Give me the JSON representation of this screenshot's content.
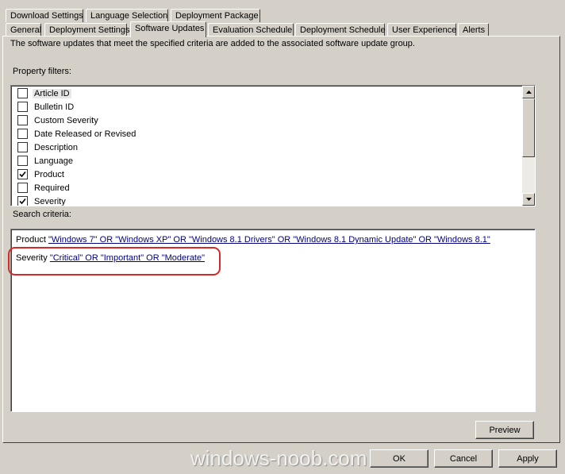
{
  "tabs_row1": [
    "Download Settings",
    "Language Selection",
    "Deployment Package"
  ],
  "tabs_row2": [
    "General",
    "Deployment Settings",
    "Software Updates",
    "Evaluation Schedule",
    "Deployment Schedule",
    "User Experience",
    "Alerts"
  ],
  "active_tab": "Software Updates",
  "description": "The software updates that meet the specified criteria are added to the associated software update group.",
  "property_filters": {
    "label": "Property filters:",
    "items": [
      {
        "label": "Article ID",
        "checked": false
      },
      {
        "label": "Bulletin ID",
        "checked": false
      },
      {
        "label": "Custom Severity",
        "checked": false
      },
      {
        "label": "Date Released or Revised",
        "checked": false
      },
      {
        "label": "Description",
        "checked": false
      },
      {
        "label": "Language",
        "checked": false
      },
      {
        "label": "Product",
        "checked": true
      },
      {
        "label": "Required",
        "checked": false
      },
      {
        "label": "Severity",
        "checked": true
      }
    ]
  },
  "search_criteria": {
    "label": "Search criteria:",
    "lines": [
      {
        "field": "Product",
        "value": "\"Windows 7\" OR \"Windows XP\" OR \"Windows 8.1 Drivers\" OR \"Windows 8.1 Dynamic Update\" OR \"Windows 8.1\""
      },
      {
        "field": "Severity",
        "value": "\"Critical\" OR \"Important\" OR \"Moderate\""
      }
    ]
  },
  "buttons": {
    "preview": "Preview",
    "ok": "OK",
    "cancel": "Cancel",
    "apply": "Apply"
  },
  "watermark": "windows-noob.com",
  "icons": {
    "scroll_up": "arrow-up-icon",
    "scroll_down": "arrow-down-icon",
    "check": "checkmark-icon"
  },
  "colors": {
    "dialog_bg": "#d4d0c8",
    "link": "#000080",
    "annotation": "#d42a2a"
  }
}
